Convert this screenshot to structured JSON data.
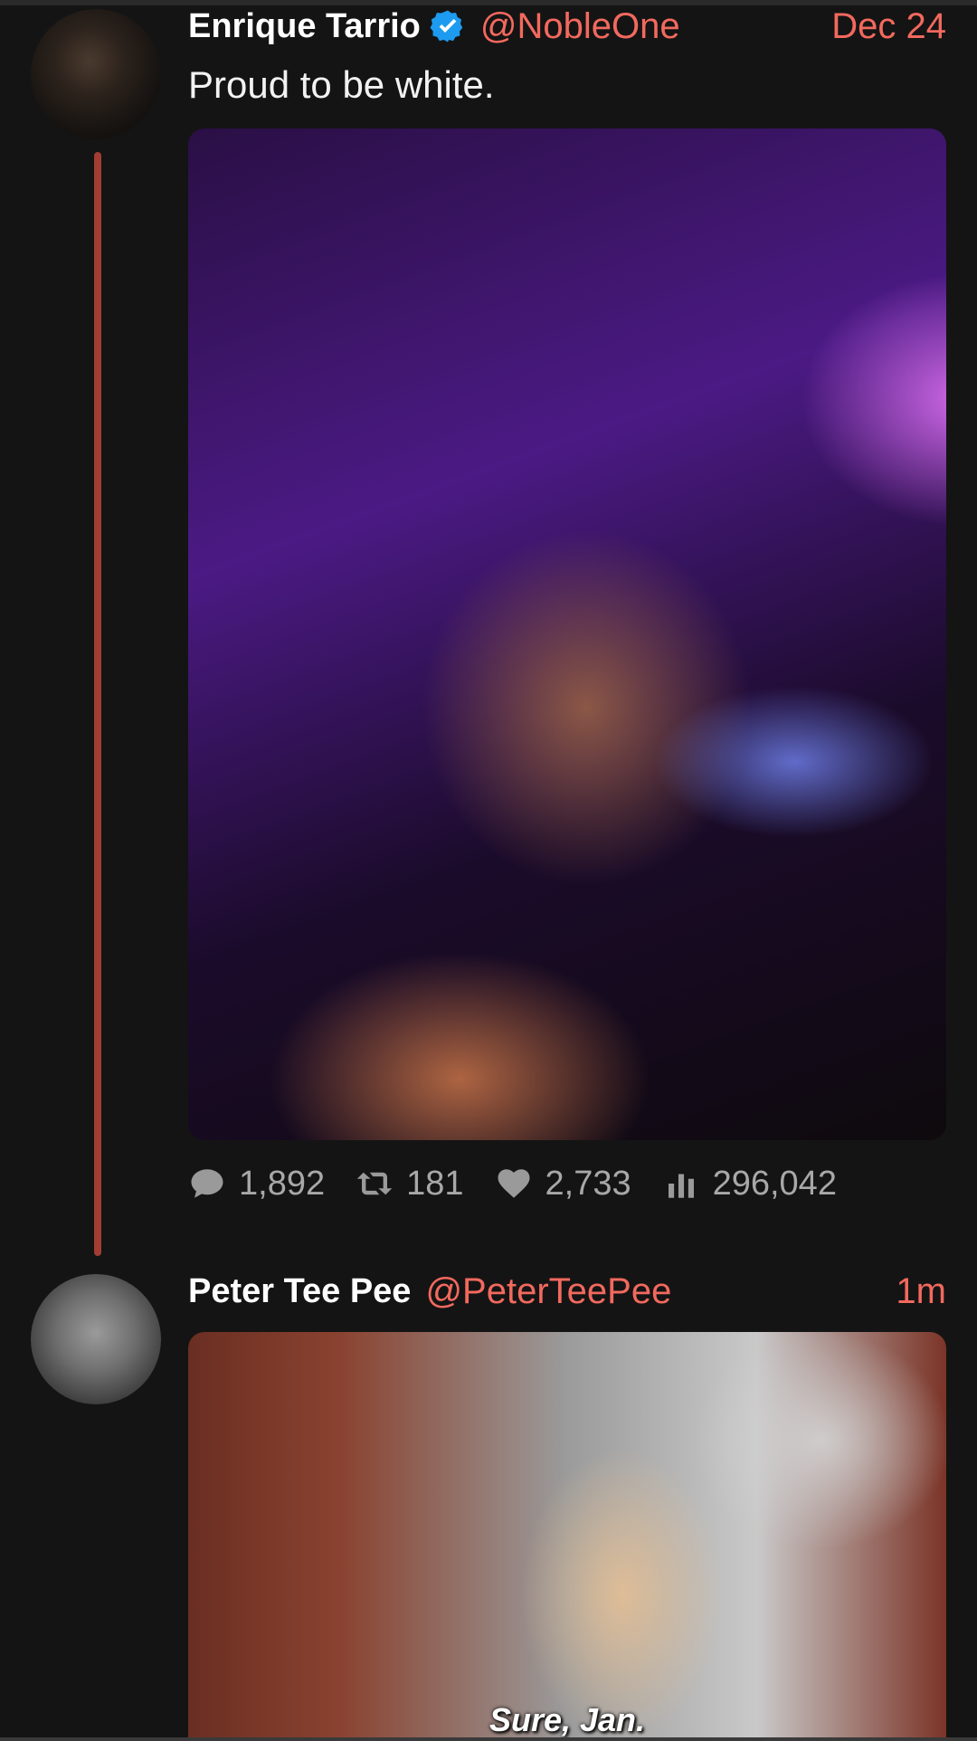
{
  "tweets": [
    {
      "name": "Enrique Tarrio",
      "verified": true,
      "handle": "@NobleOne",
      "time": "Dec 24",
      "text": "Proud to be white.",
      "stats": {
        "replies": "1,892",
        "retweets": "181",
        "likes": "2,733",
        "views": "296,042"
      }
    },
    {
      "name": "Peter Tee Pee",
      "handle": "@PeterTeePee",
      "time": "1m",
      "media_caption": "Sure, Jan."
    }
  ],
  "colors": {
    "background": "#141414",
    "accent": "#f2695e",
    "thread_line": "#a23d34",
    "verified": "#1d9bf0",
    "muted": "#a8a8a8"
  },
  "icons": [
    "reply-icon",
    "retweet-icon",
    "like-icon",
    "views-icon",
    "verified-icon"
  ]
}
